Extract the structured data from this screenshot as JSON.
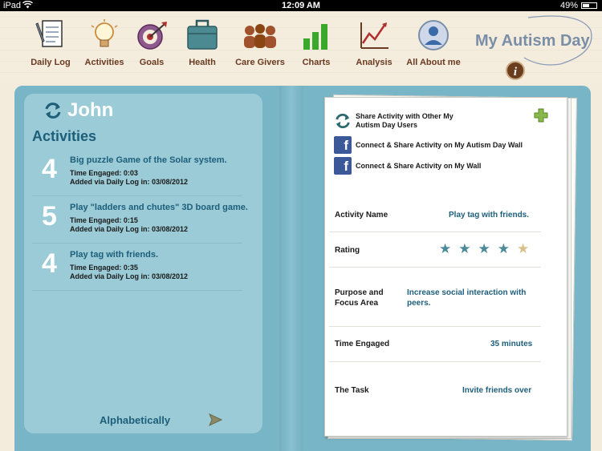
{
  "status_bar": {
    "carrier": "iPad",
    "time": "12:09 AM",
    "battery": "49%"
  },
  "nav": {
    "items": [
      {
        "label": "Daily Log",
        "icon": "daily-log-icon"
      },
      {
        "label": "Activities",
        "icon": "lightbulb-icon"
      },
      {
        "label": "Goals",
        "icon": "target-icon"
      },
      {
        "label": "Health",
        "icon": "medical-bag-icon"
      },
      {
        "label": "Care Givers",
        "icon": "people-icon"
      },
      {
        "label": "Charts",
        "icon": "bar-chart-icon"
      },
      {
        "label": "Analysis",
        "icon": "line-chart-icon"
      },
      {
        "label": "All About me",
        "icon": "profile-icon"
      }
    ]
  },
  "brand": {
    "title": "My Autism Day",
    "info_glyph": "i"
  },
  "profile": {
    "name": "John"
  },
  "activities": {
    "heading": "Activities",
    "items": [
      {
        "rating": "4",
        "title": "Big puzzle Game of the Solar system.",
        "time": "Time Engaged: 0:03",
        "added": "Added via Daily Log in: 03/08/2012"
      },
      {
        "rating": "5",
        "title": "Play \"ladders and chutes\" 3D board game.",
        "time": "Time Engaged: 0:15",
        "added": "Added via Daily Log in: 03/08/2012"
      },
      {
        "rating": "4",
        "title": "Play tag with friends.",
        "time": "Time Engaged: 0:35",
        "added": "Added via Daily Log in: 03/08/2012"
      }
    ],
    "sort_label": "Alphabetically"
  },
  "share": {
    "with_users": "Share Activity  with Other My Autism Day Users",
    "fb_autism_wall": "Connect & Share Activity on My Autism Day Wall",
    "fb_my_wall": "Connect & Share Activity on My Wall",
    "fb_glyph": "f"
  },
  "detail": {
    "activity_name_label": "Activity Name",
    "activity_name": "Play tag with friends.",
    "rating_label": "Rating",
    "rating": 4,
    "rating_max": 5,
    "star_glyph": "★",
    "purpose_label": "Purpose and Focus Area",
    "purpose": "Increase social interaction with peers.",
    "time_label": "Time Engaged",
    "time": "35 minutes",
    "task_label": "The Task",
    "task": "Invite friends over"
  },
  "colors": {
    "accent": "#1d5e7a",
    "folder": "#78b5c6",
    "panel": "#9acbd6",
    "nav_label": "#6a3a22"
  }
}
